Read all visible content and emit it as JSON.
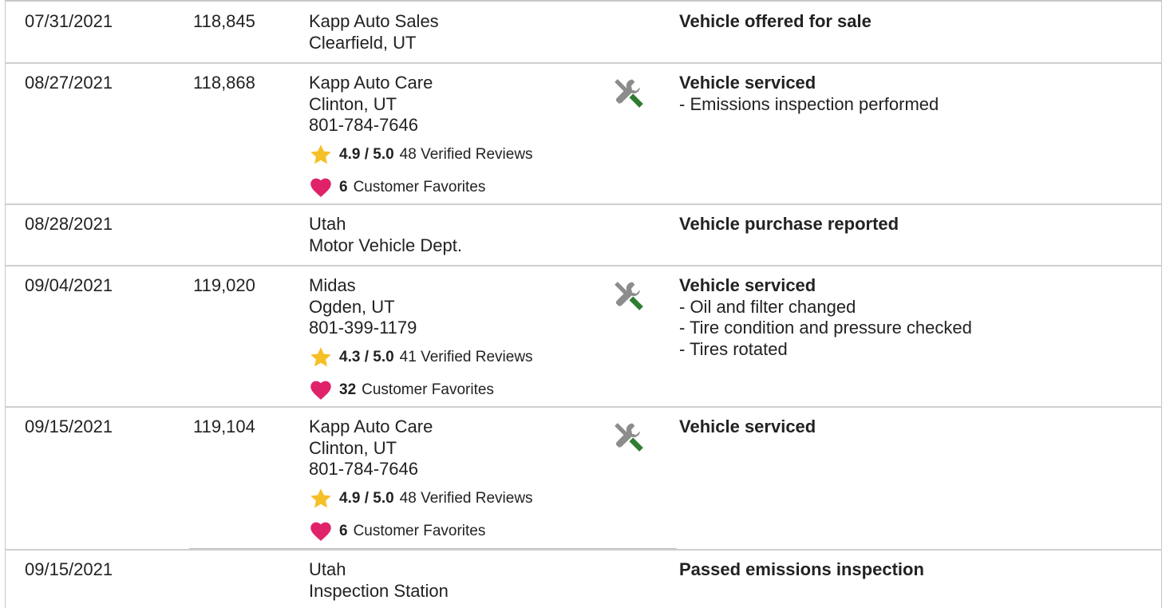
{
  "records": [
    {
      "date": "07/31/2021",
      "mileage": "118,845",
      "source_lines": [
        "Kapp Auto Sales",
        "Clearfield, UT"
      ],
      "rating": null,
      "favorites": null,
      "has_service_icon": false,
      "event": "Vehicle offered for sale",
      "details": []
    },
    {
      "date": "08/27/2021",
      "mileage": "118,868",
      "source_lines": [
        "Kapp Auto Care",
        "Clinton, UT",
        "801-784-7646"
      ],
      "rating": {
        "score": "4.9 / 5.0",
        "reviews": "48 Verified Reviews"
      },
      "favorites": {
        "count": "6",
        "label": "Customer Favorites"
      },
      "has_service_icon": true,
      "event": "Vehicle serviced",
      "details": [
        "- Emissions inspection performed"
      ]
    },
    {
      "date": "08/28/2021",
      "mileage": "",
      "source_lines": [
        "Utah",
        "Motor Vehicle Dept."
      ],
      "rating": null,
      "favorites": null,
      "has_service_icon": false,
      "event": "Vehicle purchase reported",
      "details": []
    },
    {
      "date": "09/04/2021",
      "mileage": "119,020",
      "source_lines": [
        "Midas",
        "Ogden, UT",
        "801-399-1179"
      ],
      "rating": {
        "score": "4.3 / 5.0",
        "reviews": "41 Verified Reviews"
      },
      "favorites": {
        "count": "32",
        "label": "Customer Favorites"
      },
      "has_service_icon": true,
      "event": "Vehicle serviced",
      "details": [
        "- Oil and filter changed",
        "- Tire condition and pressure checked",
        "- Tires rotated"
      ]
    },
    {
      "date": "09/15/2021",
      "mileage": "119,104",
      "source_lines": [
        "Kapp Auto Care",
        "Clinton, UT",
        "801-784-7646"
      ],
      "rating": {
        "score": "4.9 / 5.0",
        "reviews": "48 Verified Reviews"
      },
      "favorites": {
        "count": "6",
        "label": "Customer Favorites"
      },
      "has_service_icon": true,
      "event": "Vehicle serviced",
      "details": []
    },
    {
      "date": "09/15/2021",
      "mileage": "",
      "source_lines": [
        "Utah",
        "Inspection Station"
      ],
      "rating": null,
      "favorites": null,
      "has_service_icon": false,
      "event": "Passed emissions inspection",
      "details": []
    }
  ],
  "icons": {
    "service": "wrench-screwdriver-icon",
    "rating": "star-icon",
    "favorites": "heart-icon"
  },
  "colors": {
    "star": "#f5bf26",
    "heart": "#e0226b",
    "tool_gray": "#8c8c8c",
    "tool_green": "#2e7d32",
    "divider": "#cfcfcf"
  }
}
